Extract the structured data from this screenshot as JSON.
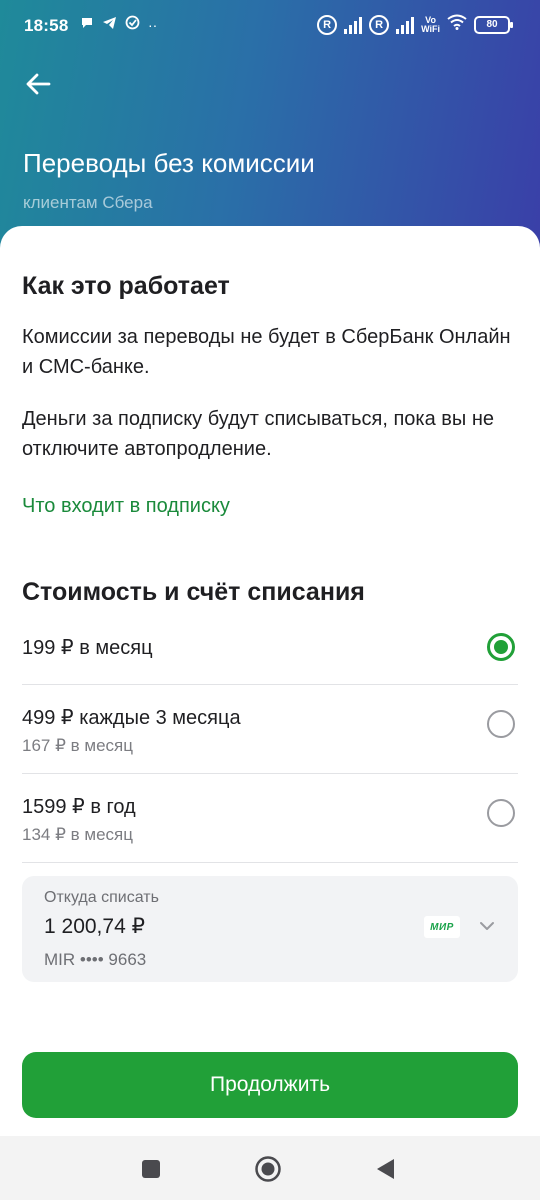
{
  "status_bar": {
    "time": "18:58",
    "left_icons": [
      "chat-bubble-icon",
      "telegram-icon",
      "check-circle-icon",
      "more-dots-icon"
    ],
    "more_dots": "··",
    "r_badge": "R",
    "vowifi_line1": "Vo",
    "vowifi_line2": "WiFi",
    "battery": "80"
  },
  "header": {
    "title": "Переводы без комиссии",
    "subtitle": "клиентам Сбера",
    "back_icon": "arrow-left-icon"
  },
  "how_it_works": {
    "title": "Как это работает",
    "paragraph1": "Комиссии за переводы не будет в СберБанк Онлайн и СМС-банке.",
    "paragraph2": "Деньги за подписку будут списываться, пока вы не отключите автопродление.",
    "link": "Что входит в подписку"
  },
  "pricing": {
    "title": "Стоимость и счёт списания",
    "options": [
      {
        "title": "199 ₽ в месяц",
        "subtitle": "",
        "selected": true
      },
      {
        "title": "499 ₽ каждые 3 месяца",
        "subtitle": "167 ₽ в месяц",
        "selected": false
      },
      {
        "title": "1599 ₽ в год",
        "subtitle": "134 ₽ в месяц",
        "selected": false
      }
    ]
  },
  "source": {
    "label": "Откуда списать",
    "amount": "1 200,74 ₽",
    "card": "MIR •••• 9663",
    "card_logo": "МИР",
    "chevron_icon": "chevron-down-icon"
  },
  "continue_label": "Продолжить",
  "colors": {
    "accent_green": "#21a038",
    "link_green": "#1a8a3b",
    "header_gradient_start": "#1f8a9a",
    "header_gradient_end": "#3a3fa8"
  },
  "nav": {
    "icons": [
      "recent-apps-square-icon",
      "home-circle-icon",
      "back-triangle-icon"
    ]
  }
}
